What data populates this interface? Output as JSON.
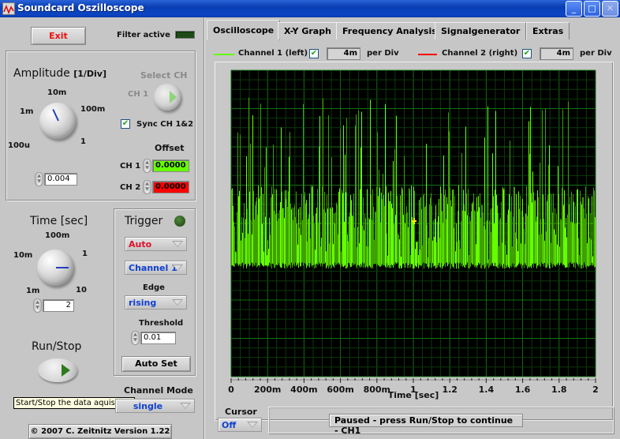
{
  "window": {
    "title": "Soundcard Oszilloscope",
    "app_icon": "oscilloscope-wave-icon",
    "buttons": {
      "minimize": "_",
      "maximize": "□",
      "close": "✕"
    }
  },
  "left_panel": {
    "exit_label": "Exit",
    "filter_label": "Filter active",
    "filter_led_color": "#1e4a16",
    "amplitude": {
      "title": "Amplitude",
      "unit": "[1/Div]",
      "knob_labels": [
        "100u",
        "1m",
        "10m",
        "100m",
        "1"
      ],
      "value": "0.004"
    },
    "select_ch": {
      "title": "Select CH",
      "label": "CH 1"
    },
    "sync": {
      "label": "Sync CH 1&2",
      "checked": true
    },
    "offset": {
      "title": "Offset",
      "ch1_label": "CH 1",
      "ch1_value": "0.0000",
      "ch1_color": "#66ff00",
      "ch2_label": "CH 2",
      "ch2_value": "0.0000",
      "ch2_color": "#ff0000"
    },
    "time": {
      "title": "Time [sec]",
      "knob_labels": [
        "1m",
        "10m",
        "100m",
        "1",
        "10"
      ],
      "value": "2"
    },
    "trigger": {
      "title": "Trigger",
      "led_color": "#2c5a20",
      "mode": "Auto",
      "mode_color": "#e0102a",
      "channel": "Channel 1",
      "edge_label": "Edge",
      "edge": "rising",
      "threshold_label": "Threshold",
      "threshold_value": "0.01",
      "autoset_label": "Auto Set"
    },
    "run_stop": {
      "title": "Run/Stop",
      "tooltip": "Start/Stop the data aquisition"
    },
    "channel_mode": {
      "label": "Channel Mode",
      "value": "single"
    },
    "copyright": "© 2007   C. Zeitnitz Version 1.22"
  },
  "tabs": [
    {
      "label": "Oscilloscope",
      "active": true
    },
    {
      "label": "X-Y Graph",
      "active": false
    },
    {
      "label": "Frequency Analysis",
      "active": false
    },
    {
      "label": "Signalgenerator",
      "active": false
    },
    {
      "label": "Extras",
      "active": false
    }
  ],
  "channels": [
    {
      "label": "Channel 1 (left)",
      "color": "#66ff00",
      "enabled": true,
      "per_div": "4m",
      "per_div_label": "per Div"
    },
    {
      "label": "Channel 2 (right)",
      "color": "#ff0000",
      "enabled": true,
      "per_div": "4m",
      "per_div_label": "per Div"
    }
  ],
  "cursor": {
    "label": "Cursor",
    "value": "Off"
  },
  "status": "Paused - press Run/Stop to continue - CH1",
  "chart_data": {
    "type": "line",
    "title": "",
    "xlabel": "Time [sec]",
    "ylabel": "",
    "xlim": [
      0,
      2
    ],
    "x_ticks": [
      "0",
      "200m",
      "400m",
      "600m",
      "800m",
      "1",
      "1.2",
      "1.4",
      "1.6",
      "1.8",
      "2"
    ],
    "x_divisions": 10,
    "y_divisions": 8,
    "grid": true,
    "background": "#000000",
    "grid_color": "#0d5a0d",
    "series": [
      {
        "name": "Channel 1 (left)",
        "color": "#66ff00",
        "description": "noisy burst signal; baseline about 1.1 div below center, dense band up to ~1 div above center, spikes reaching ~3.3 div above center",
        "baseline_div": -1.1,
        "band_top_div": 1.0,
        "spike_max_div": 3.3
      }
    ]
  }
}
